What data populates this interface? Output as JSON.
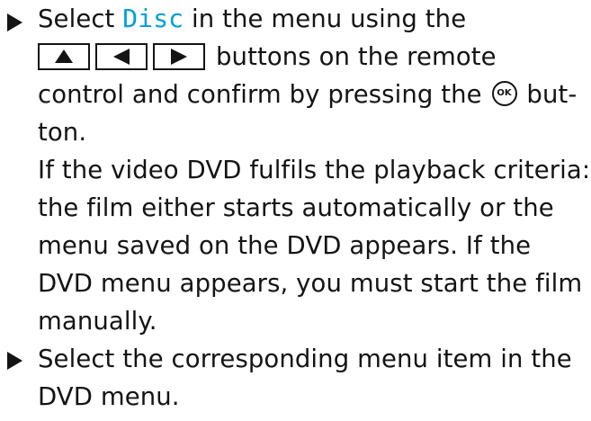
{
  "step1": {
    "line1_pre": "Select ",
    "disc_label": "Disc",
    "line1_post": " in the menu using the",
    "key_up_label": "▲",
    "key_left_label": "◀",
    "key_right_label": "▶",
    "line2_post": "buttons on the remote",
    "line3_pre": "control and confirm by pressing the ",
    "ok_label": "OK",
    "line3_post": " but-",
    "line4": "ton.",
    "line5": "If the video DVD fulfils the playback criteria:",
    "line6": "the film either starts automatically or the",
    "line7": "menu saved on the DVD appears. If the",
    "line8": "DVD menu appears, you must start the film",
    "line9": "manually."
  },
  "step2": {
    "line1": "Select the corresponding menu item in the",
    "line2": "DVD menu."
  },
  "colors": {
    "text": "#141414",
    "accent": "#00a0d8"
  }
}
